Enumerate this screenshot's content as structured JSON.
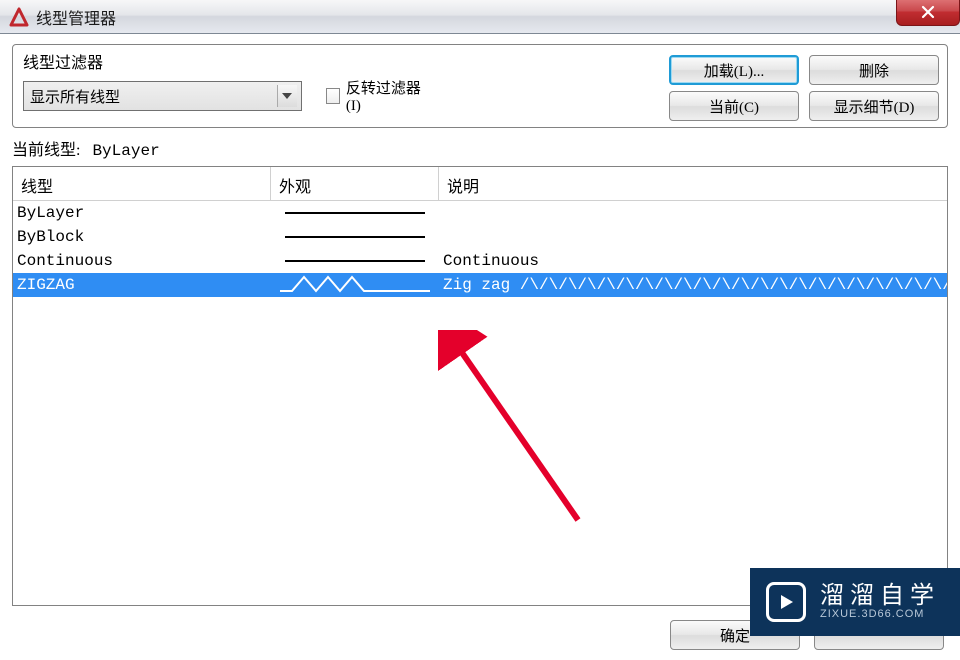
{
  "title": "线型管理器",
  "filter": {
    "group_label": "线型过滤器",
    "dropdown_value": "显示所有线型",
    "invert_label": "反转过滤器(I)"
  },
  "buttons": {
    "load": "加载(L)...",
    "delete": "删除",
    "current": "当前(C)",
    "details": "显示细节(D)",
    "ok": "确定"
  },
  "current_linetype": {
    "label": "当前线型:",
    "value": "ByLayer"
  },
  "table": {
    "headers": {
      "type": "线型",
      "appearance": "外观",
      "description": "说明"
    },
    "rows": [
      {
        "name": "ByLayer",
        "appearance": "solid",
        "description": "",
        "selected": false
      },
      {
        "name": "ByBlock",
        "appearance": "solid",
        "description": "",
        "selected": false
      },
      {
        "name": "Continuous",
        "appearance": "solid",
        "description": "Continuous",
        "selected": false
      },
      {
        "name": "ZIGZAG",
        "appearance": "zigzag",
        "description": "Zig zag /\\/\\/\\/\\/\\/\\/\\/\\/\\/\\/\\/\\/\\/\\/\\/\\/\\/\\/\\/\\/\\/\\/\\/\\",
        "selected": true
      }
    ]
  },
  "watermark": {
    "cn": "溜溜自学",
    "en": "ZIXUE.3D66.COM"
  }
}
